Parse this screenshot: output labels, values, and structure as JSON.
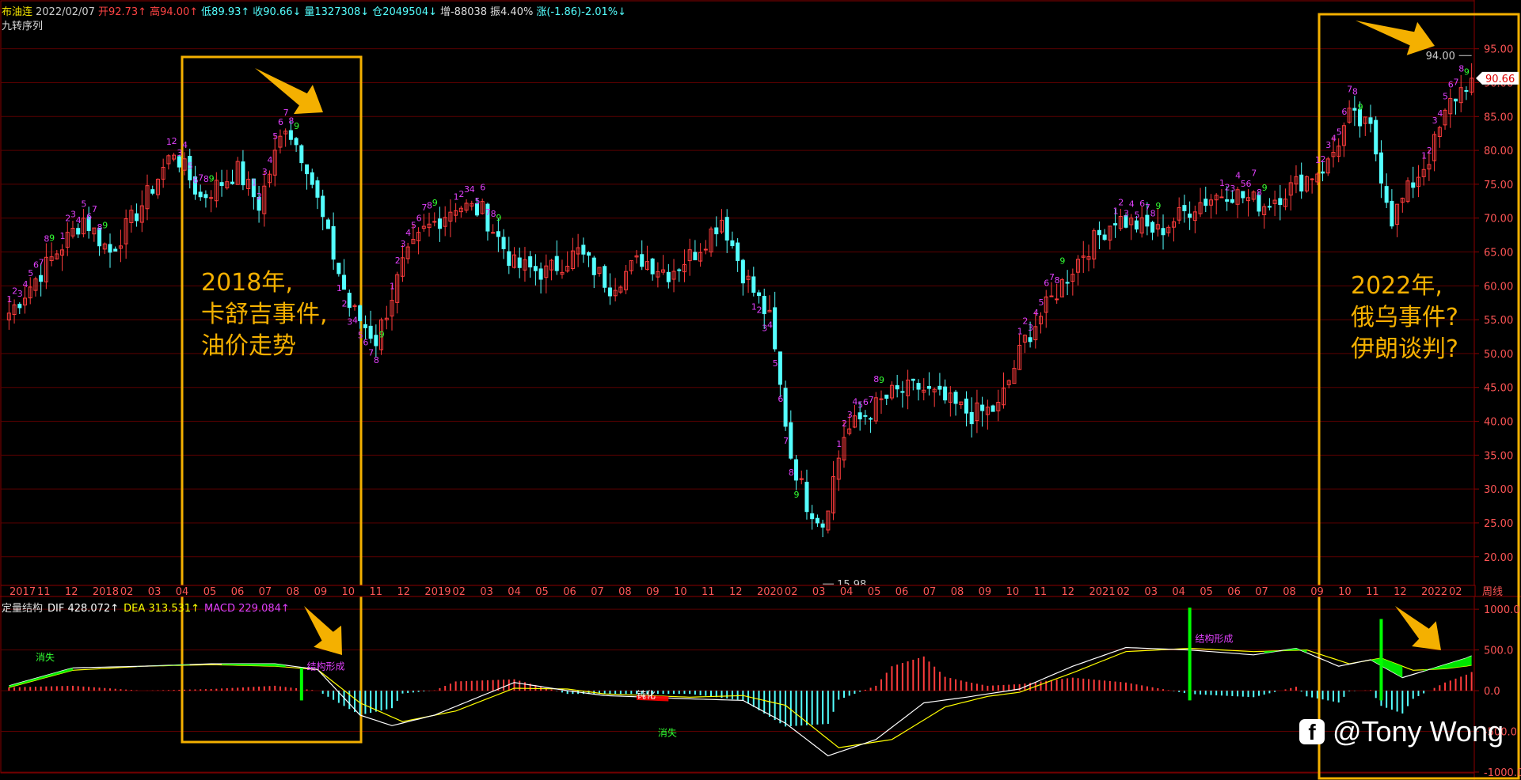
{
  "header": {
    "symbol": "布油连",
    "date": "2022/02/07",
    "open": "开92.73↑",
    "high": "高94.00↑",
    "low": "低89.93↑",
    "close": "收90.66↓",
    "volume": "量1327308↓",
    "oi": "仓2049504↓",
    "oi_change": "增-88038",
    "amplitude": "振4.40%",
    "change": "涨(-1.86)-2.01%↓",
    "indicator": "九转序列"
  },
  "macd_header": {
    "name": "定量结构",
    "dif": "DIF 428.072↑",
    "dea": "DEA 313.531↑",
    "macd": "MACD 229.084↑"
  },
  "annotations": {
    "left": [
      "2018年,",
      "卡舒吉事件,",
      "油价走势"
    ],
    "right": [
      "2022年,",
      "俄乌事件?",
      "伊朗谈判?"
    ]
  },
  "watermark": {
    "icon": "facebook-icon",
    "text": "@Tony Wong"
  },
  "labels": {
    "period": "周线",
    "last_price": "90.66",
    "high_label": "94.00",
    "low_label": "15.98",
    "macd_marks": [
      "消失",
      "结构形成",
      "钝化",
      "消失",
      "结构形成"
    ]
  },
  "colors": {
    "up": "#ff3c3c",
    "down": "#54ffff",
    "highlight_box": "#f4b000",
    "dif": "#ffffff",
    "dea": "#ffff00",
    "macd_struct": "#00ff00",
    "seq_purple": "#e040fb",
    "seq_green": "#33ff33"
  },
  "chart_data": [
    {
      "type": "candlestick",
      "y_ticks": [
        20,
        25,
        30,
        35,
        40,
        45,
        50,
        55,
        60,
        65,
        70,
        75,
        80,
        85,
        90,
        95
      ],
      "ylim": [
        16,
        98
      ],
      "x_tick_labels": [
        "2017",
        "11",
        "12",
        "2018",
        "02",
        "03",
        "04",
        "05",
        "06",
        "07",
        "08",
        "09",
        "10",
        "11",
        "12",
        "2019",
        "02",
        "03",
        "04",
        "05",
        "06",
        "07",
        "08",
        "09",
        "10",
        "11",
        "12",
        "2020",
        "02",
        "03",
        "04",
        "05",
        "06",
        "07",
        "08",
        "09",
        "10",
        "11",
        "12",
        "2021",
        "02",
        "03",
        "04",
        "05",
        "06",
        "07",
        "08",
        "09",
        "10",
        "11",
        "12",
        "2022",
        "02"
      ],
      "last_price": 90.66,
      "high_mark": 94.0,
      "low_mark": 15.98,
      "anchors": [
        [
          0,
          56
        ],
        [
          6,
          62
        ],
        [
          14,
          70
        ],
        [
          19,
          65
        ],
        [
          25,
          72
        ],
        [
          31,
          80
        ],
        [
          36,
          73
        ],
        [
          43,
          77
        ],
        [
          47,
          72
        ],
        [
          52,
          84
        ],
        [
          56,
          78
        ],
        [
          60,
          67
        ],
        [
          64,
          57
        ],
        [
          69,
          52
        ],
        [
          74,
          63
        ],
        [
          78,
          68
        ],
        [
          84,
          72
        ],
        [
          89,
          71
        ],
        [
          95,
          63
        ],
        [
          101,
          62
        ],
        [
          107,
          65
        ],
        [
          113,
          60
        ],
        [
          119,
          64
        ],
        [
          124,
          62
        ],
        [
          129,
          65
        ],
        [
          134,
          70
        ],
        [
          138,
          62
        ],
        [
          143,
          55
        ],
        [
          147,
          35
        ],
        [
          150,
          28
        ],
        [
          153,
          25
        ],
        [
          157,
          38
        ],
        [
          161,
          41
        ],
        [
          166,
          44
        ],
        [
          171,
          45
        ],
        [
          176,
          43
        ],
        [
          181,
          41
        ],
        [
          186,
          42
        ],
        [
          191,
          52
        ],
        [
          196,
          58
        ],
        [
          202,
          65
        ],
        [
          208,
          70
        ],
        [
          216,
          68
        ],
        [
          223,
          72
        ],
        [
          229,
          74
        ],
        [
          236,
          72
        ],
        [
          242,
          75
        ],
        [
          248,
          78
        ],
        [
          252,
          85
        ],
        [
          256,
          83
        ],
        [
          260,
          70
        ],
        [
          263,
          74
        ],
        [
          267,
          79
        ],
        [
          271,
          87
        ],
        [
          275,
          91
        ]
      ]
    },
    {
      "type": "macd",
      "y_ticks": [
        -1000,
        -500,
        0,
        500,
        1000
      ],
      "ylim": [
        -1000,
        1050
      ],
      "dif": 428.072,
      "dea": 313.531,
      "macd": 229.084,
      "dif_anchors": [
        [
          0,
          60
        ],
        [
          12,
          280
        ],
        [
          25,
          300
        ],
        [
          38,
          330
        ],
        [
          50,
          330
        ],
        [
          58,
          260
        ],
        [
          66,
          -300
        ],
        [
          72,
          -430
        ],
        [
          80,
          -300
        ],
        [
          95,
          100
        ],
        [
          105,
          0
        ],
        [
          112,
          -60
        ],
        [
          120,
          -80
        ],
        [
          128,
          -100
        ],
        [
          138,
          -120
        ],
        [
          146,
          -400
        ],
        [
          154,
          -800
        ],
        [
          163,
          -600
        ],
        [
          172,
          -150
        ],
        [
          180,
          -80
        ],
        [
          190,
          20
        ],
        [
          200,
          300
        ],
        [
          210,
          530
        ],
        [
          222,
          500
        ],
        [
          234,
          440
        ],
        [
          242,
          520
        ],
        [
          250,
          300
        ],
        [
          256,
          380
        ],
        [
          262,
          160
        ],
        [
          268,
          280
        ],
        [
          275,
          420
        ]
      ],
      "dea_anchors": [
        [
          0,
          40
        ],
        [
          12,
          250
        ],
        [
          25,
          300
        ],
        [
          38,
          320
        ],
        [
          50,
          300
        ],
        [
          58,
          260
        ],
        [
          66,
          -150
        ],
        [
          74,
          -380
        ],
        [
          84,
          -250
        ],
        [
          95,
          30
        ],
        [
          105,
          20
        ],
        [
          112,
          -40
        ],
        [
          120,
          -60
        ],
        [
          128,
          -80
        ],
        [
          138,
          -60
        ],
        [
          146,
          -180
        ],
        [
          156,
          -700
        ],
        [
          166,
          -600
        ],
        [
          176,
          -200
        ],
        [
          184,
          -70
        ],
        [
          190,
          -20
        ],
        [
          200,
          220
        ],
        [
          210,
          480
        ],
        [
          222,
          520
        ],
        [
          234,
          480
        ],
        [
          244,
          500
        ],
        [
          252,
          330
        ],
        [
          258,
          400
        ],
        [
          264,
          250
        ],
        [
          270,
          270
        ],
        [
          275,
          310
        ]
      ]
    }
  ]
}
